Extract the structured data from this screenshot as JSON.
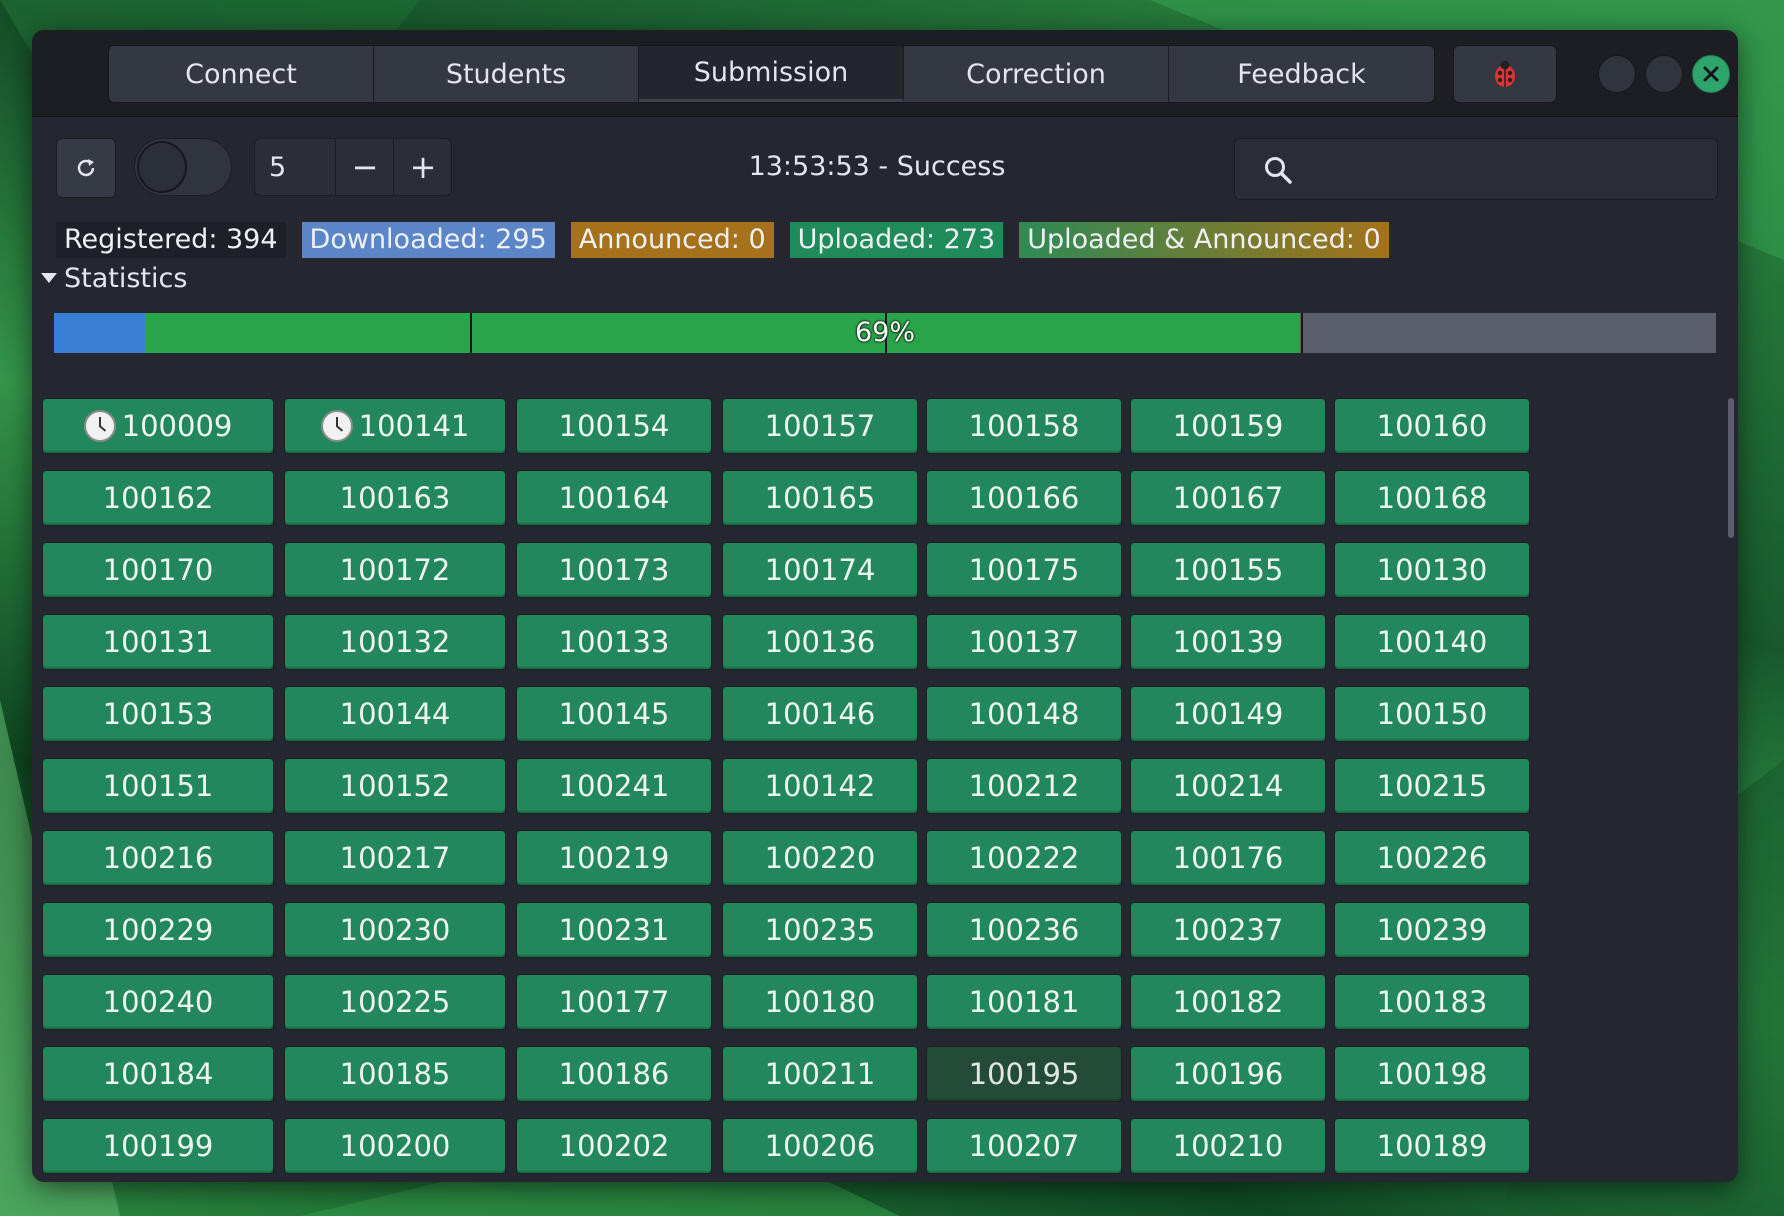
{
  "tabs": [
    {
      "label": "Connect"
    },
    {
      "label": "Students"
    },
    {
      "label": "Submission",
      "active": true
    },
    {
      "label": "Correction"
    },
    {
      "label": "Feedback"
    }
  ],
  "bug_button_icon": "ladybug-icon",
  "toolbar": {
    "spin_value": "5",
    "minus_label": "−",
    "plus_label": "+",
    "status_text": "13:53:53 - Success",
    "search_placeholder": ""
  },
  "counts": {
    "registered": "Registered: 394",
    "downloaded": "Downloaded: 295",
    "announced": "Announced: 0",
    "uploaded": "Uploaded: 273",
    "uploaded_announced": "Uploaded & Announced: 0"
  },
  "statistics_label": "Statistics",
  "progress": {
    "label": "69%",
    "segments": [
      {
        "name": "downloaded",
        "fraction": 0.055,
        "color": "#3a7fd6"
      },
      {
        "name": "uploaded",
        "fraction": 0.695,
        "color": "#2aa44a"
      }
    ]
  },
  "colors": {
    "tile": "#22875a",
    "tile_selected": "#244b38"
  },
  "students": [
    {
      "id": "100009",
      "pending": true
    },
    {
      "id": "100141",
      "pending": true
    },
    {
      "id": "100154"
    },
    {
      "id": "100157"
    },
    {
      "id": "100158"
    },
    {
      "id": "100159"
    },
    {
      "id": "100160"
    },
    {
      "id": "100162"
    },
    {
      "id": "100163"
    },
    {
      "id": "100164"
    },
    {
      "id": "100165"
    },
    {
      "id": "100166"
    },
    {
      "id": "100167"
    },
    {
      "id": "100168"
    },
    {
      "id": "100170"
    },
    {
      "id": "100172"
    },
    {
      "id": "100173"
    },
    {
      "id": "100174"
    },
    {
      "id": "100175"
    },
    {
      "id": "100155"
    },
    {
      "id": "100130"
    },
    {
      "id": "100131"
    },
    {
      "id": "100132"
    },
    {
      "id": "100133"
    },
    {
      "id": "100136"
    },
    {
      "id": "100137"
    },
    {
      "id": "100139"
    },
    {
      "id": "100140"
    },
    {
      "id": "100153"
    },
    {
      "id": "100144"
    },
    {
      "id": "100145"
    },
    {
      "id": "100146"
    },
    {
      "id": "100148"
    },
    {
      "id": "100149"
    },
    {
      "id": "100150"
    },
    {
      "id": "100151"
    },
    {
      "id": "100152"
    },
    {
      "id": "100241"
    },
    {
      "id": "100142"
    },
    {
      "id": "100212"
    },
    {
      "id": "100214"
    },
    {
      "id": "100215"
    },
    {
      "id": "100216"
    },
    {
      "id": "100217"
    },
    {
      "id": "100219"
    },
    {
      "id": "100220"
    },
    {
      "id": "100222"
    },
    {
      "id": "100176"
    },
    {
      "id": "100226"
    },
    {
      "id": "100229"
    },
    {
      "id": "100230"
    },
    {
      "id": "100231"
    },
    {
      "id": "100235"
    },
    {
      "id": "100236"
    },
    {
      "id": "100237"
    },
    {
      "id": "100239"
    },
    {
      "id": "100240"
    },
    {
      "id": "100225"
    },
    {
      "id": "100177"
    },
    {
      "id": "100180"
    },
    {
      "id": "100181"
    },
    {
      "id": "100182"
    },
    {
      "id": "100183"
    },
    {
      "id": "100184"
    },
    {
      "id": "100185"
    },
    {
      "id": "100186"
    },
    {
      "id": "100211"
    },
    {
      "id": "100195",
      "selected": true
    },
    {
      "id": "100196"
    },
    {
      "id": "100198"
    },
    {
      "id": "100199"
    },
    {
      "id": "100200"
    },
    {
      "id": "100202"
    },
    {
      "id": "100206"
    },
    {
      "id": "100207"
    },
    {
      "id": "100210"
    },
    {
      "id": "100189"
    }
  ]
}
